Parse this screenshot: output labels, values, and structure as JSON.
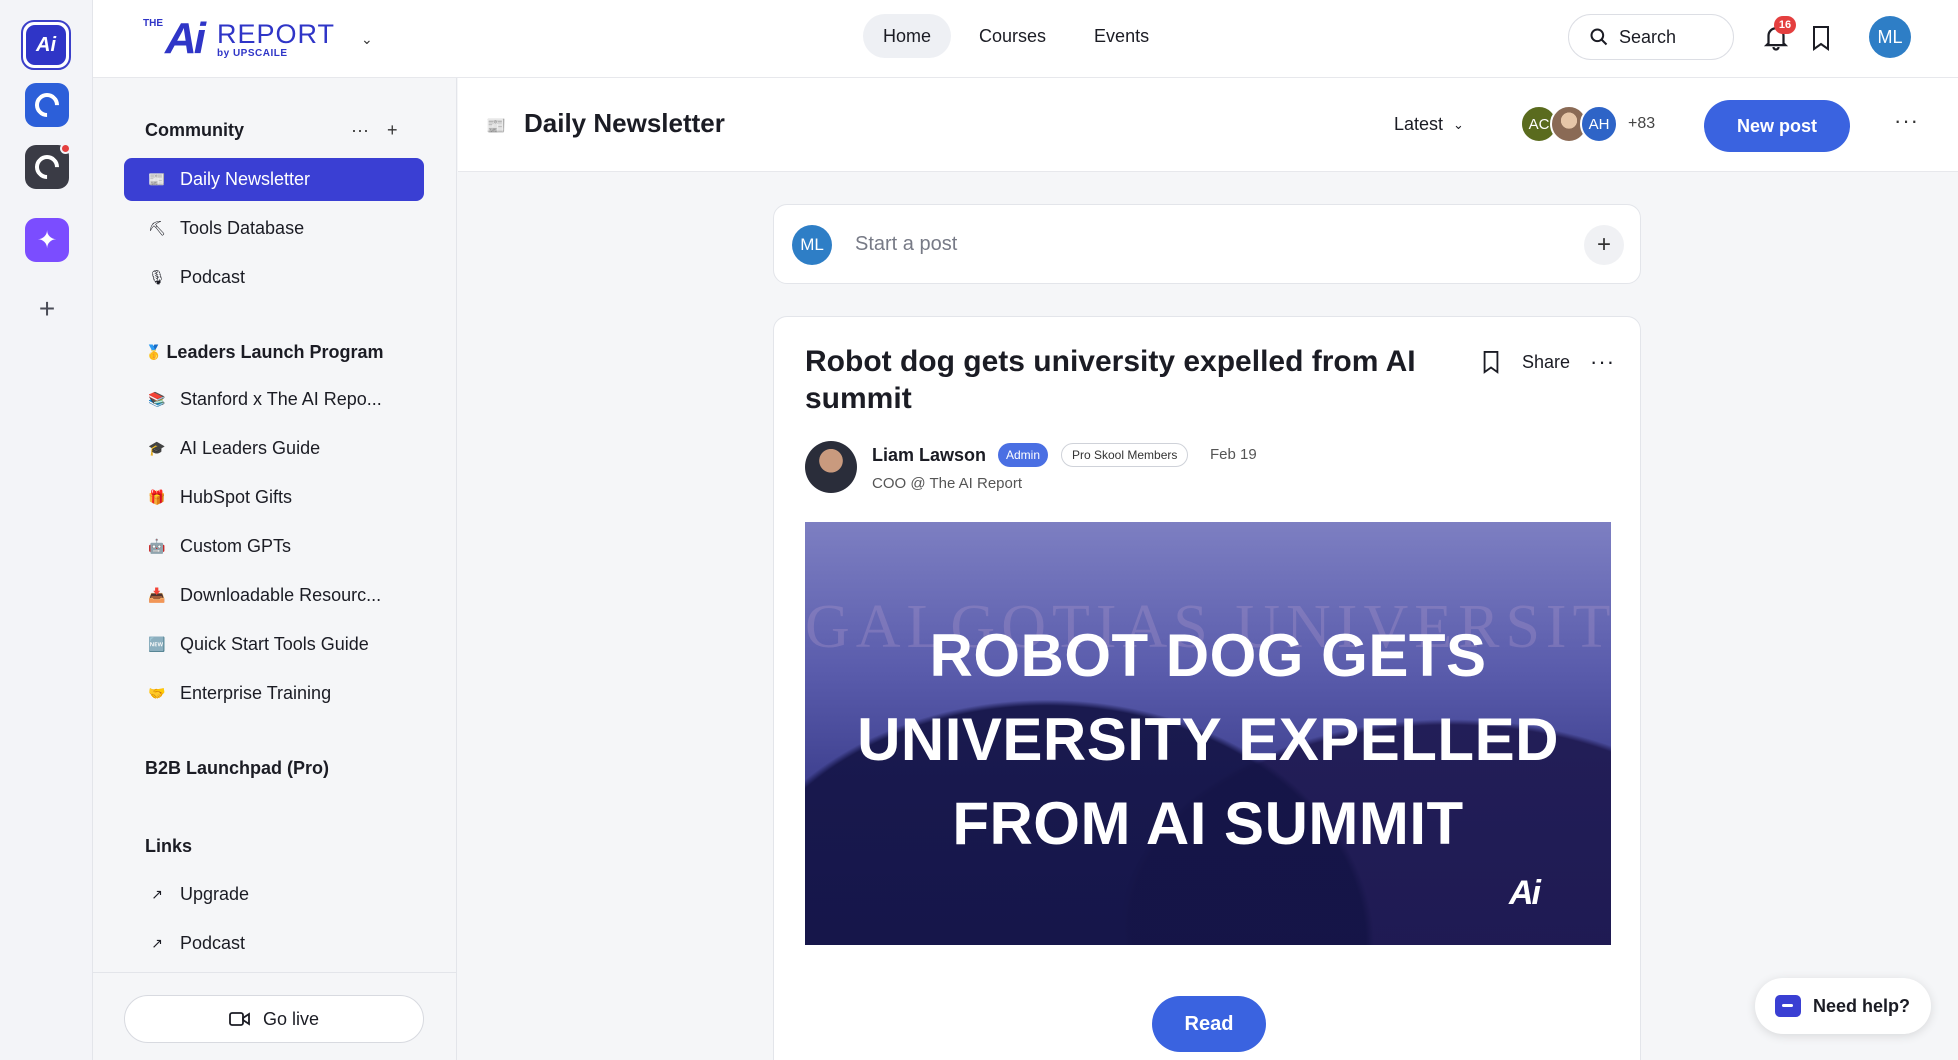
{
  "colors": {
    "brand": "#2f35c7",
    "accent": "#3a63e0",
    "active_nav": "#3a3fd3",
    "badge_red": "#e43f3f"
  },
  "rail": {
    "items": [
      {
        "name": "ai-report-community",
        "icon": "ai-logo-icon",
        "label": "Ai"
      },
      {
        "name": "c-community-1",
        "icon": "c-logo-icon"
      },
      {
        "name": "c-community-2",
        "icon": "c-logo-icon"
      },
      {
        "name": "spark-community",
        "icon": "sparkle-icon"
      },
      {
        "name": "add-community",
        "icon": "plus-icon"
      }
    ]
  },
  "header": {
    "logo": {
      "the": "THE",
      "ai": "Ai",
      "report": "REPORT",
      "by": "by UPSCAILE"
    },
    "nav": [
      {
        "label": "Home",
        "active": true
      },
      {
        "label": "Courses",
        "active": false
      },
      {
        "label": "Events",
        "active": false
      }
    ],
    "search_label": "Search",
    "notification_count": "16",
    "user_initials": "ML"
  },
  "sidebar": {
    "community_title": "Community",
    "community_items": [
      {
        "icon": "📰",
        "label": "Daily Newsletter",
        "active": true
      },
      {
        "icon": "⛏",
        "label": "Tools Database",
        "active": false
      },
      {
        "icon": "🎙",
        "label": "Podcast",
        "active": false
      }
    ],
    "leaders_title": "Leaders Launch Program",
    "leaders_icon": "🥇",
    "leaders_items": [
      {
        "icon": "📚",
        "label": "Stanford x The AI Repo..."
      },
      {
        "icon": "🎓",
        "label": "AI Leaders Guide"
      },
      {
        "icon": "🎁",
        "label": "HubSpot Gifts"
      },
      {
        "icon": "🤖",
        "label": "Custom GPTs"
      },
      {
        "icon": "📥",
        "label": "Downloadable Resourc..."
      },
      {
        "icon": "🆕",
        "label": "Quick Start Tools Guide"
      },
      {
        "icon": "🤝",
        "label": "Enterprise Training"
      }
    ],
    "b2b_title": "B2B Launchpad (Pro)",
    "links_title": "Links",
    "links_items": [
      {
        "icon": "↗",
        "label": "Upgrade"
      },
      {
        "icon": "↗",
        "label": "Podcast"
      }
    ],
    "go_live_label": "Go live"
  },
  "main": {
    "title": "Daily Newsletter",
    "sort_label": "Latest",
    "member_avatars": [
      {
        "initials": "AC",
        "color": "#5a6b1e"
      },
      {
        "initials": "",
        "color": "#8a6a55"
      },
      {
        "initials": "AH",
        "color": "#2e64c7"
      }
    ],
    "member_more": "+83",
    "new_post_label": "New post"
  },
  "composer": {
    "user_initials": "ML",
    "placeholder": "Start a post"
  },
  "post": {
    "title": "Robot dog gets university expelled from AI summit",
    "share_label": "Share",
    "author_name": "Liam Lawson",
    "admin_badge": "Admin",
    "member_badge": "Pro Skool Members",
    "date": "Feb 19",
    "author_role": "COO @ The AI Report",
    "hero_heading": "ROBOT DOG GETS UNIVERSITY EXPELLED FROM AI SUMMIT",
    "hero_bg_text": "GALGOTIAS UNIVERSITY",
    "hero_logo": "Ai",
    "read_label": "Read"
  },
  "help_label": "Need help?"
}
